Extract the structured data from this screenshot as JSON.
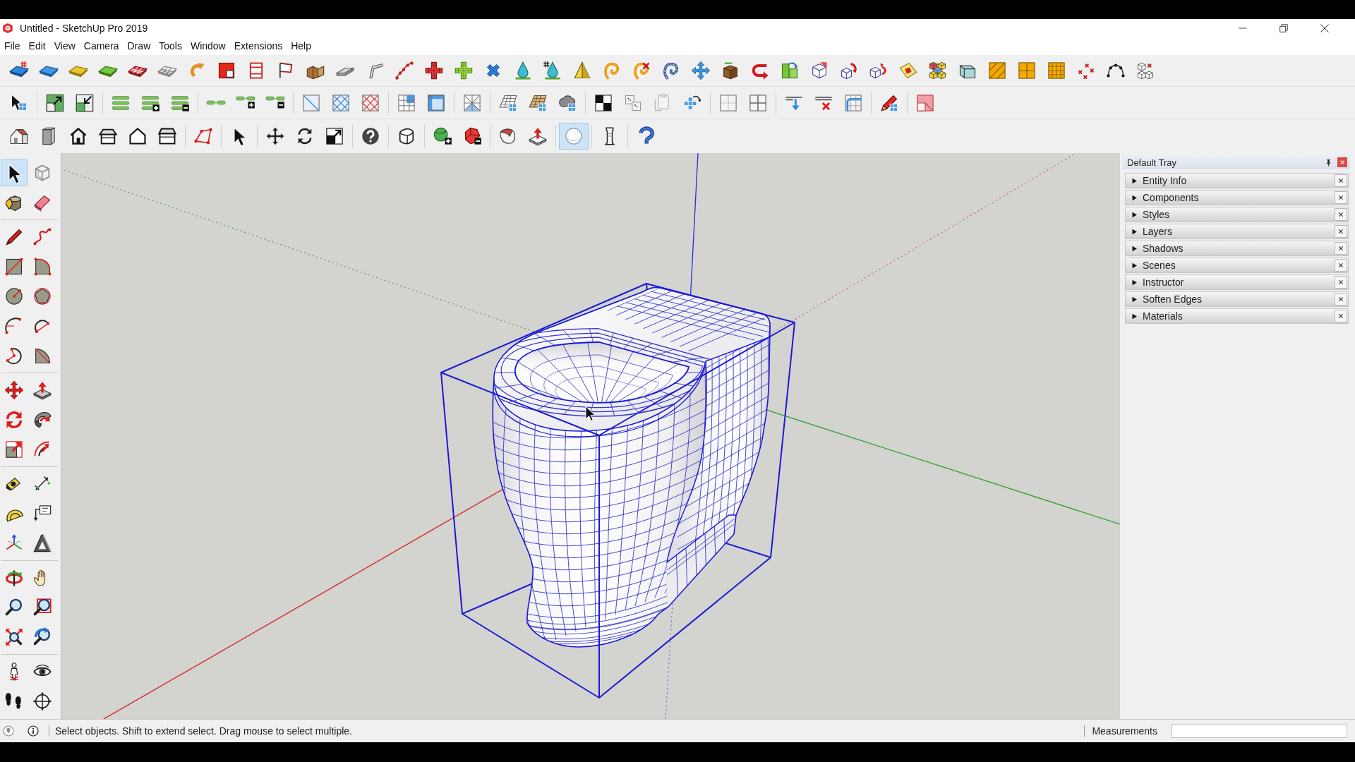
{
  "window": {
    "title": "Untitled - SketchUp Pro 2019"
  },
  "menu": [
    "File",
    "Edit",
    "View",
    "Camera",
    "Draw",
    "Tools",
    "Window",
    "Extensions",
    "Help"
  ],
  "toolbars": [
    {
      "groups": [
        [
          {
            "selected": false
          },
          {
            "selected": false
          },
          {
            "selected": false
          },
          {
            "selected": false
          },
          {
            "selected": false
          },
          {
            "selected": false
          },
          {
            "selected": false
          },
          {
            "selected": false
          },
          {
            "selected": false
          },
          {
            "selected": false
          },
          {
            "selected": false
          },
          {
            "selected": false
          },
          {
            "selected": false
          },
          {
            "selected": false
          },
          {
            "selected": false
          },
          {
            "selected": false
          },
          {
            "selected": false
          },
          {
            "selected": false
          },
          {
            "selected": false
          },
          {
            "selected": false
          },
          {
            "selected": false
          },
          {
            "selected": false
          },
          {
            "selected": false
          },
          {
            "selected": false
          },
          {
            "selected": false
          },
          {
            "selected": false
          },
          {
            "selected": false
          },
          {
            "selected": false
          },
          {
            "selected": false
          },
          {
            "selected": false
          },
          {
            "selected": false
          },
          {
            "selected": false
          },
          {
            "selected": false
          },
          {
            "selected": false
          },
          {
            "selected": false
          },
          {
            "selected": false
          },
          {
            "selected": false
          },
          {
            "selected": false
          },
          {
            "selected": false
          }
        ]
      ]
    },
    {
      "groups": [
        [
          {
            "selected": false
          }
        ],
        [
          {
            "selected": false
          },
          {
            "selected": false
          }
        ],
        [
          {
            "selected": false
          },
          {
            "selected": false
          },
          {
            "selected": false
          }
        ],
        [
          {
            "selected": false
          },
          {
            "selected": false
          },
          {
            "selected": false
          }
        ],
        [
          {
            "selected": false
          },
          {
            "selected": false
          },
          {
            "selected": false
          }
        ],
        [
          {
            "selected": false
          },
          {
            "selected": false
          }
        ],
        [
          {
            "selected": false
          }
        ],
        [
          {
            "selected": false
          },
          {
            "selected": false
          },
          {
            "selected": false
          }
        ],
        [
          {
            "selected": false
          },
          {
            "selected": false
          },
          {
            "selected": false
          },
          {
            "selected": false
          }
        ],
        [
          {
            "selected": false
          },
          {
            "selected": false
          }
        ],
        [
          {
            "selected": false
          },
          {
            "selected": false
          },
          {
            "selected": false
          }
        ],
        [
          {
            "selected": false
          }
        ],
        [
          {
            "selected": false
          }
        ]
      ]
    },
    {
      "groups": [
        [
          {
            "selected": false
          },
          {
            "selected": false
          },
          {
            "selected": false
          },
          {
            "selected": false
          },
          {
            "selected": false
          },
          {
            "selected": false
          }
        ],
        [
          {
            "selected": false
          }
        ],
        [
          {
            "selected": false
          }
        ],
        [
          {
            "selected": false
          },
          {
            "selected": false
          },
          {
            "selected": false
          }
        ],
        [
          {
            "selected": false
          }
        ],
        [
          {
            "selected": false
          }
        ],
        [
          {
            "selected": false
          },
          {
            "selected": false
          }
        ],
        [
          {
            "selected": false
          },
          {
            "selected": false
          }
        ],
        [
          {
            "selected": true
          }
        ],
        [
          {
            "selected": false
          }
        ],
        [
          {
            "selected": false
          }
        ]
      ]
    }
  ],
  "tool_palette": {
    "groups": [
      [
        {
          "selected": true
        },
        {
          "selected": false
        },
        {
          "selected": false
        },
        {
          "selected": false
        }
      ],
      [
        {
          "selected": false
        },
        {
          "selected": false
        },
        {
          "selected": false
        },
        {
          "selected": false
        },
        {
          "selected": false
        },
        {
          "selected": false
        },
        {
          "selected": false
        },
        {
          "selected": false
        },
        {
          "selected": false
        },
        {
          "selected": false
        }
      ],
      [
        {
          "selected": false
        },
        {
          "selected": false
        },
        {
          "selected": false
        },
        {
          "selected": false
        },
        {
          "selected": false
        },
        {
          "selected": false
        }
      ],
      [
        {
          "selected": false
        },
        {
          "selected": false
        },
        {
          "selected": false
        },
        {
          "selected": false
        },
        {
          "selected": false
        },
        {
          "selected": false
        }
      ],
      [
        {
          "selected": false
        },
        {
          "selected": false
        },
        {
          "selected": false
        },
        {
          "selected": false
        },
        {
          "selected": false
        },
        {
          "selected": false
        }
      ],
      [
        {
          "selected": false
        },
        {
          "selected": false
        },
        {
          "selected": false
        },
        {
          "selected": false
        }
      ]
    ]
  },
  "tray": {
    "title": "Default Tray",
    "panels": [
      {
        "label": "Entity Info",
        "expanded": false
      },
      {
        "label": "Components",
        "expanded": false
      },
      {
        "label": "Styles",
        "expanded": false
      },
      {
        "label": "Layers",
        "expanded": false
      },
      {
        "label": "Shadows",
        "expanded": false
      },
      {
        "label": "Scenes",
        "expanded": false
      },
      {
        "label": "Instructor",
        "expanded": false
      },
      {
        "label": "Soften Edges",
        "expanded": false
      },
      {
        "label": "Materials",
        "expanded": false
      }
    ]
  },
  "status_bar": {
    "hint": "Select objects. Shift to extend select. Drag mouse to select multiple.",
    "measurements_label": "Measurements"
  }
}
